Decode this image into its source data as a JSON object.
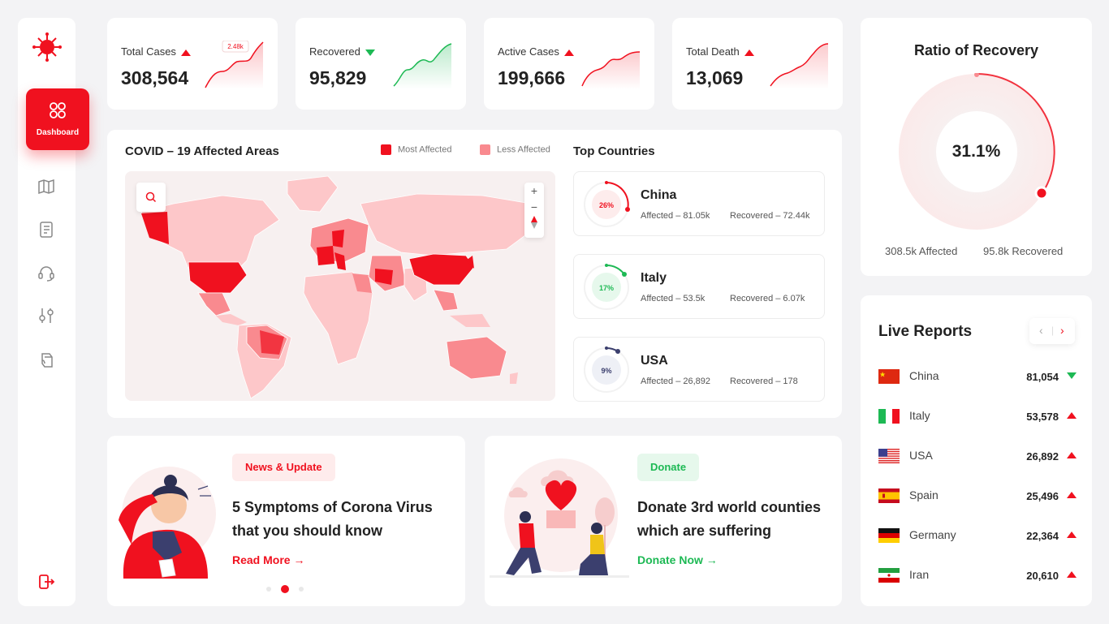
{
  "sidebar": {
    "dashboard_label": "Dashboard",
    "brand_color": "#f0111f"
  },
  "stats": [
    {
      "label": "Total Cases",
      "value": "308,564",
      "trend": "up",
      "tooltip": "2.48k"
    },
    {
      "label": "Recovered",
      "value": "95,829",
      "trend": "down"
    },
    {
      "label": "Active Cases",
      "value": "199,666",
      "trend": "up"
    },
    {
      "label": "Total Death",
      "value": "13,069",
      "trend": "up"
    }
  ],
  "map": {
    "title": "COVID – 19 Affected Areas",
    "legend_most": "Most Affected",
    "legend_less": "Less Affected",
    "zoom_in": "+",
    "zoom_out": "−",
    "colors": {
      "most": "#f0111f",
      "less": "#f98a8f",
      "base": "#fdc7c9"
    }
  },
  "top_countries": {
    "title": "Top Countries",
    "items": [
      {
        "name": "China",
        "percent": "26%",
        "affected": "Affected – 81.05k",
        "recovered": "Recovered – 72.44k"
      },
      {
        "name": "Italy",
        "percent": "17%",
        "affected": "Affected – 53.5k",
        "recovered": "Recovered – 6.07k"
      },
      {
        "name": "USA",
        "percent": "9%",
        "affected": "Affected – 26,892",
        "recovered": "Recovered – 178"
      }
    ]
  },
  "news": [
    {
      "badge": "News & Update",
      "title": "5 Symptoms of Corona Virus that you should know",
      "link": "Read More →"
    },
    {
      "badge": "Donate",
      "title": "Donate 3rd world counties which are suffering",
      "link": "Donate Now →"
    }
  ],
  "ratio": {
    "title": "Ratio of Recovery",
    "value": "31.1%",
    "affected": "308.5k Affected",
    "recovered": "95.8k Recovered"
  },
  "live_reports": {
    "title": "Live Reports",
    "prev": "‹",
    "next": "›",
    "rows": [
      {
        "country": "China",
        "value": "81,054",
        "trend": "down"
      },
      {
        "country": "Italy",
        "value": "53,578",
        "trend": "up"
      },
      {
        "country": "USA",
        "value": "26,892",
        "trend": "up"
      },
      {
        "country": "Spain",
        "value": "25,496",
        "trend": "up"
      },
      {
        "country": "Germany",
        "value": "22,364",
        "trend": "up"
      },
      {
        "country": "Iran",
        "value": "20,610",
        "trend": "up"
      }
    ]
  }
}
